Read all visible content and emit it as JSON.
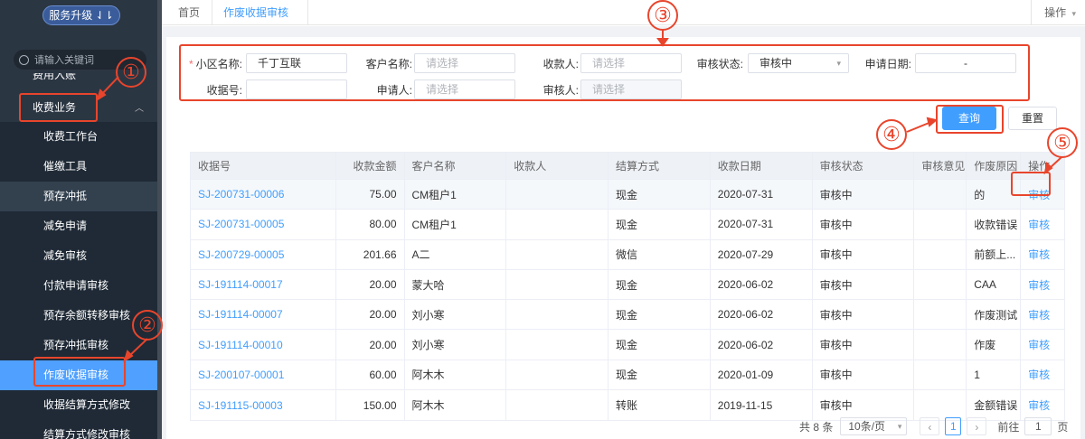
{
  "sidebar": {
    "upgrade_label": "服务升级 ⇃⇂",
    "search_placeholder": "请输入关键词",
    "cut_item": "费用入账",
    "section": "收费业务",
    "items": [
      "收费工作台",
      "催缴工具",
      "预存冲抵",
      "减免申请",
      "减免审核",
      "付款申请审核",
      "预存余额转移审核",
      "预存冲抵审核",
      "作废收据审核",
      "收据结算方式修改",
      "结算方式修改审核"
    ]
  },
  "tabs": {
    "home": "首页",
    "active": "作废收据审核",
    "ops": "操作"
  },
  "filters": {
    "community_label": "小区名称:",
    "community_value": "千丁互联",
    "customer_label": "客户名称:",
    "customer_placeholder": "请选择",
    "payee_label": "收款人:",
    "payee_placeholder": "请选择",
    "status_label": "审核状态:",
    "status_value": "审核中",
    "date_label": "申请日期:",
    "date_sep": "-",
    "receipt_label": "收据号:",
    "applicant_label": "申请人:",
    "applicant_placeholder": "请选择",
    "reviewer_label": "审核人:",
    "reviewer_placeholder": "请选择"
  },
  "buttons": {
    "query": "查询",
    "reset": "重置"
  },
  "table": {
    "headers": [
      "收据号",
      "收款金额",
      "客户名称",
      "收款人",
      "结算方式",
      "收款日期",
      "审核状态",
      "审核意见",
      "作废原因",
      "操作"
    ],
    "rows": [
      [
        "SJ-200731-00006",
        "75.00",
        "CM租户1",
        "",
        "现金",
        "2020-07-31",
        "审核中",
        "",
        "的",
        "审核"
      ],
      [
        "SJ-200731-00005",
        "80.00",
        "CM租户1",
        "",
        "现金",
        "2020-07-31",
        "审核中",
        "",
        "收款错误",
        "审核"
      ],
      [
        "SJ-200729-00005",
        "201.66",
        "A二",
        "",
        "微信",
        "2020-07-29",
        "审核中",
        "",
        "前额上...",
        "审核"
      ],
      [
        "SJ-191114-00017",
        "20.00",
        "蒙大哈",
        "",
        "现金",
        "2020-06-02",
        "审核中",
        "",
        "CAA",
        "审核"
      ],
      [
        "SJ-191114-00007",
        "20.00",
        "刘小寒",
        "",
        "现金",
        "2020-06-02",
        "审核中",
        "",
        "作废测试",
        "审核"
      ],
      [
        "SJ-191114-00010",
        "20.00",
        "刘小寒",
        "",
        "现金",
        "2020-06-02",
        "审核中",
        "",
        "作废",
        "审核"
      ],
      [
        "SJ-200107-00001",
        "60.00",
        "阿木木",
        "",
        "现金",
        "2020-01-09",
        "审核中",
        "",
        "1",
        "审核"
      ],
      [
        "SJ-191115-00003",
        "150.00",
        "阿木木",
        "",
        "转账",
        "2019-11-15",
        "审核中",
        "",
        "金额错误",
        "审核"
      ]
    ]
  },
  "pager": {
    "total": "共 8 条",
    "size": "10条/页",
    "page": "1",
    "goto_label": "前往",
    "goto_value": "1",
    "page_unit": "页"
  },
  "annotations": [
    "①",
    "②",
    "③",
    "④",
    "⑤"
  ],
  "colors": {
    "accent": "#409eff",
    "annotation": "#e8452c",
    "sidebar": "#2b3643"
  }
}
